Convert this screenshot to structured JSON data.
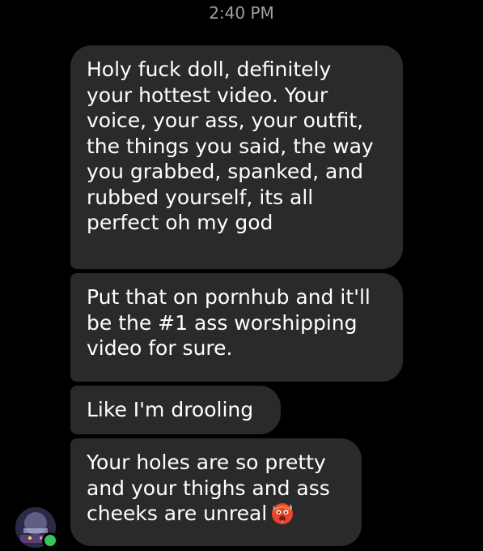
{
  "timestamp": "2:40 PM",
  "messages": [
    {
      "text": "Holy fuck doll, definitely\nyour hottest video. Your\nvoice, your ass, your outfit,\nthe things you said, the way\nyou grabbed, spanked, and\nrubbed yourself, its all\nperfect oh my god"
    },
    {
      "text": "Put that on pornhub and it'll\nbe the #1 ass worshipping\nvideo for sure."
    },
    {
      "text": "Like I'm drooling"
    },
    {
      "text": "Your holes are so pretty\nand your thighs and ass\ncheeks are unreal",
      "emoji": "hot-face-emoji"
    }
  ],
  "avatar": {
    "online": true,
    "status_color": "#35c759"
  },
  "colors": {
    "background": "#000000",
    "bubble": "#2a2a2a",
    "timestamp": "#a0a0a0"
  }
}
